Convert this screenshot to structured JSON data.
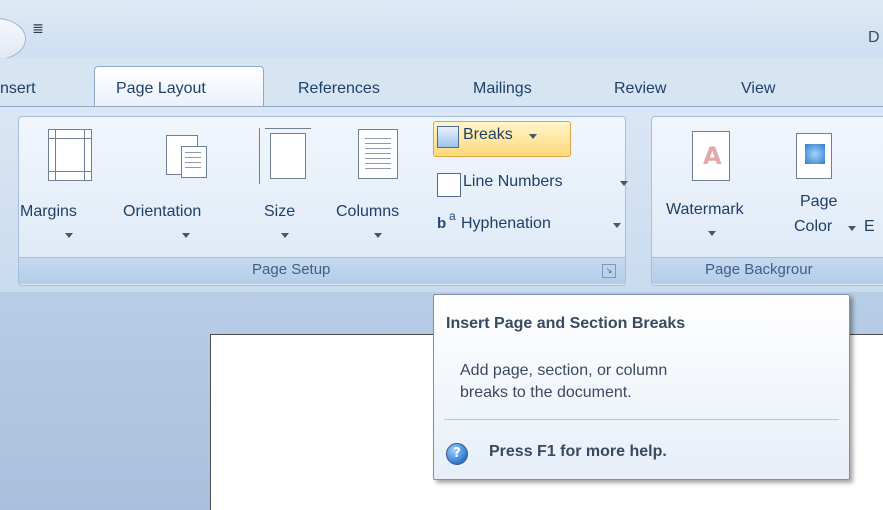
{
  "title_bar": {
    "quick_access_dropdown": "≣",
    "window_title_partial": "D"
  },
  "tabs": [
    {
      "label": "nsert",
      "active": false
    },
    {
      "label": "Page Layout",
      "active": true
    },
    {
      "label": "References",
      "active": false
    },
    {
      "label": "Mailings",
      "active": false
    },
    {
      "label": "Review",
      "active": false
    },
    {
      "label": "View",
      "active": false
    }
  ],
  "ribbon": {
    "page_setup": {
      "label": "Page Setup",
      "buttons": {
        "margins": "Margins",
        "orientation": "Orientation",
        "size": "Size",
        "columns": "Columns"
      },
      "small_buttons": {
        "breaks": "Breaks",
        "line_numbers": "Line Numbers",
        "hyphenation": "Hyphenation"
      }
    },
    "page_background": {
      "label": "Page Backgrour",
      "buttons": {
        "watermark": "Watermark",
        "page_color_line1": "Page",
        "page_color_line2": "Color",
        "partial": "E"
      }
    }
  },
  "tooltip": {
    "title": "Insert Page and Section Breaks",
    "body_line1": "Add page, section, or column",
    "body_line2": "breaks to the document.",
    "help": "Press F1 for more help."
  },
  "colors": {
    "ribbon_background": "#d7e4f2",
    "breaks_highlight": "#ffd87a",
    "help_icon": "#2f79c9"
  }
}
